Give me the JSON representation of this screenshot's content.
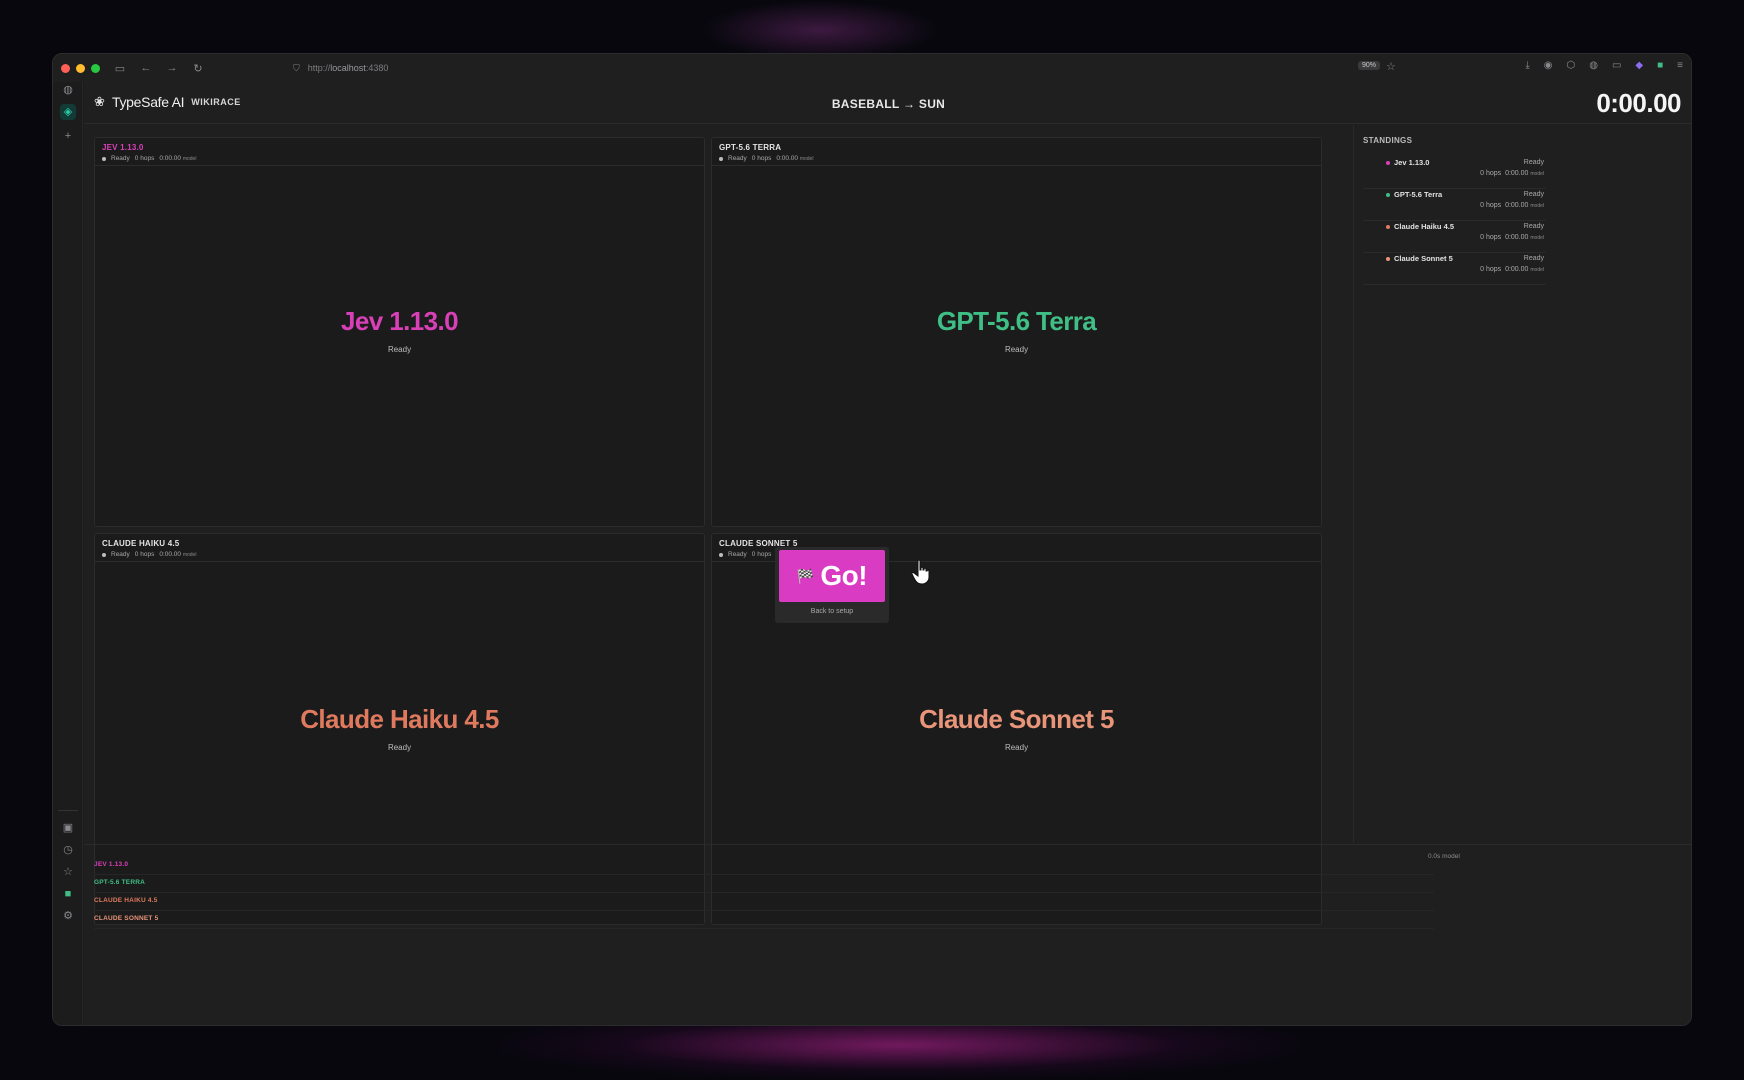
{
  "browser": {
    "url_prefix": "http://",
    "url_host": "localhost",
    "url_port": ":4380",
    "zoom": "90%"
  },
  "header": {
    "logo_text": "TypeSafe AI",
    "logo_sub": "WIKIRACE",
    "race_title": "BASEBALL → SUN",
    "timer": "0:00.00"
  },
  "panels": [
    {
      "name": "JEV 1.13.0",
      "display": "Jev 1.13.0",
      "status": "Ready",
      "hops": "0 hops",
      "time": "0:00.00",
      "time_unit": "model",
      "color": "#d940b8"
    },
    {
      "name": "GPT-5.6 TERRA",
      "display": "GPT-5.6 Terra",
      "status": "Ready",
      "hops": "0 hops",
      "time": "0:00.00",
      "time_unit": "model",
      "color": "#3fbf86"
    },
    {
      "name": "CLAUDE HAIKU 4.5",
      "display": "Claude Haiku 4.5",
      "status": "Ready",
      "hops": "0 hops",
      "time": "0:00.00",
      "time_unit": "model",
      "color": "#e07a5f"
    },
    {
      "name": "CLAUDE SONNET 5",
      "display": "Claude Sonnet 5",
      "status": "Ready",
      "hops": "0 hops",
      "time": "0:00.00",
      "time_unit": "model",
      "color": "#e8957a"
    }
  ],
  "standings": {
    "title": "STANDINGS",
    "rows": [
      {
        "name": "Jev 1.13.0",
        "status": "Ready",
        "hops": "0 hops",
        "time": "0:00.00",
        "unit": "model",
        "color": "#d940b8"
      },
      {
        "name": "GPT-5.6 Terra",
        "status": "Ready",
        "hops": "0 hops",
        "time": "0:00.00",
        "unit": "model",
        "color": "#3fbf86"
      },
      {
        "name": "Claude Haiku 4.5",
        "status": "Ready",
        "hops": "0 hops",
        "time": "0:00.00",
        "unit": "model",
        "color": "#e07a5f"
      },
      {
        "name": "Claude Sonnet 5",
        "status": "Ready",
        "hops": "0 hops",
        "time": "0:00.00",
        "unit": "model",
        "color": "#e8957a"
      }
    ]
  },
  "timeline": {
    "scale": "0.0s model",
    "rows": [
      {
        "label": "JEV 1.13.0",
        "color": "#d940b8"
      },
      {
        "label": "GPT-5.6 TERRA",
        "color": "#3fbf86"
      },
      {
        "label": "CLAUDE HAIKU 4.5",
        "color": "#e07a5f"
      },
      {
        "label": "CLAUDE SONNET 5",
        "color": "#e8957a"
      }
    ]
  },
  "go": {
    "flag": "🏁",
    "label": "Go!",
    "back": "Back to setup"
  }
}
